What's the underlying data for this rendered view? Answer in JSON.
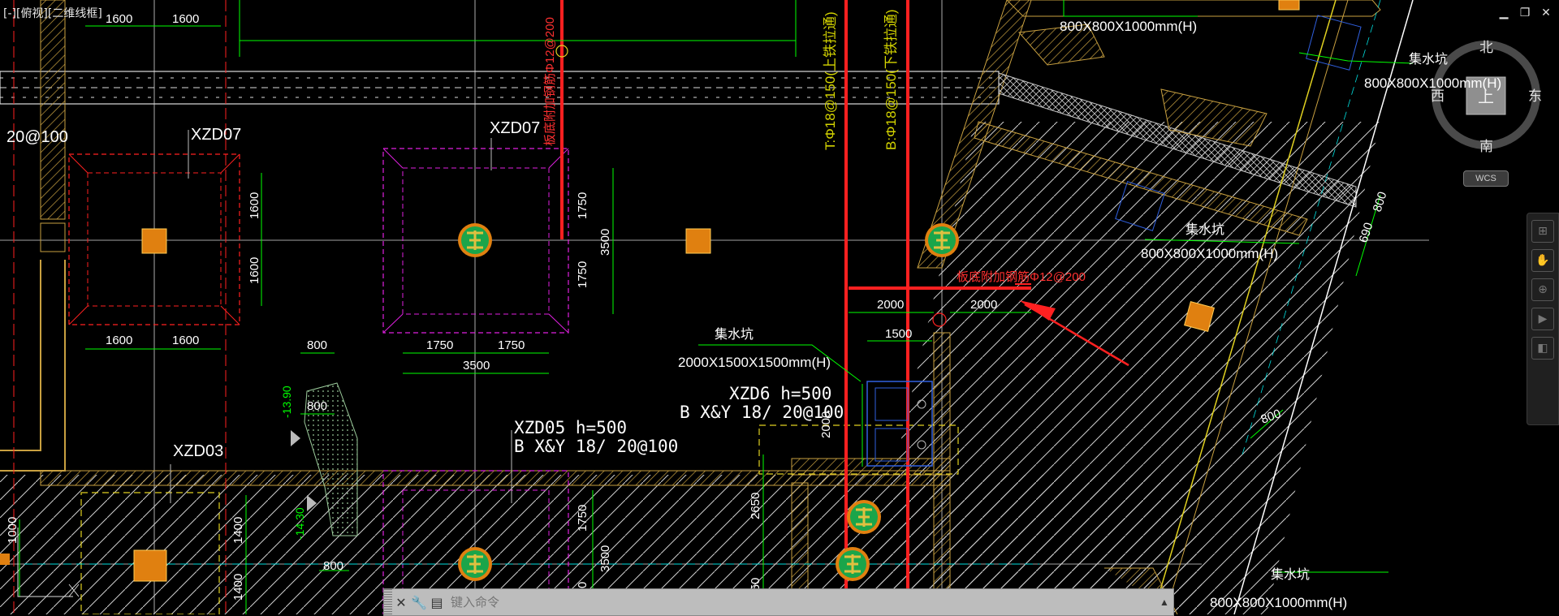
{
  "viewport": {
    "label": "[-][俯视][二维线框]"
  },
  "window_controls": {
    "minimize": "▁",
    "restore": "❐",
    "close": "✕"
  },
  "viewcube": {
    "north": "北",
    "south": "南",
    "east": "东",
    "west": "西",
    "face": "上",
    "wcs": "WCS"
  },
  "command_line": {
    "placeholder": "键入命令",
    "close_label": "✕",
    "settings_label": "🔧",
    "history_label": "▤",
    "expand_label": "▲"
  },
  "nav_bar": {
    "items": [
      "⊞",
      "✋",
      "⊕",
      "▶",
      "◧"
    ]
  },
  "drawing": {
    "labels": {
      "xzd07_left": "XZD07",
      "xzd07_mid": "XZD07",
      "xzd03": "XZD03",
      "xzd05": "XZD05  h=500",
      "xzd05_b": "B X&Y   18/   20@100",
      "xzd6": "XZD6  h=500",
      "xzd6_b": "B X&Y   18/   20@100",
      "rebar_left": "20@100",
      "pit1_name": "集水坑",
      "pit1_size": "2000X1500X1500mm(H)",
      "pit2_size": "800X800X1000mm(H)",
      "pit3_name": "集水坑",
      "pit3_size": "800X800X1000mm(H)",
      "pit4_name": "集水坑",
      "pit4_size": "800X800X1000mm(H)",
      "pit5_name": "集水坑",
      "pit5_size": "800X800X1000mm(H)",
      "top_rebar": "T:Φ18@150(上铁拉通)",
      "bot_rebar": "B:Φ18@150(下铁拉通)",
      "red_note_v": "板底附加钢筋Φ12@200",
      "red_note_h": "板底附加钢筋Φ12@200",
      "elev1": "-13.90",
      "elev2": "-14.30"
    },
    "dims": {
      "d1600_a": "1600",
      "d1600_b": "1600",
      "d1600_c": "1600",
      "d1600_d": "1600",
      "d1600_e": "1600",
      "d1600_f": "1600",
      "d1750_a": "1750",
      "d1750_b": "1750",
      "d3500_a": "3500",
      "d1750_c": "1750",
      "d1750_d": "1750",
      "d3500_b": "3500",
      "d800_a": "800",
      "d800_b": "800",
      "d800_c": "800",
      "d2000_a": "2000",
      "d2000_b": "2000",
      "d1500": "1500",
      "d2000_c": "2000",
      "d2650": "2650",
      "d1400_a": "1400",
      "d1400_b": "1400",
      "d1750_e": "1750",
      "d3500_c": "3500",
      "d1750_f": "1750",
      "d1550": "1550",
      "d1000": "1000",
      "d800_r1": "800",
      "d690": "690",
      "d800_r2": "800"
    }
  },
  "colors": {
    "background": "#000000",
    "dim": "#00ff00",
    "pit_magenta": "#e020e0",
    "red": "#ff2020",
    "yellow": "#e0d020",
    "hatch": "#c8a040",
    "column": "#e08010"
  }
}
